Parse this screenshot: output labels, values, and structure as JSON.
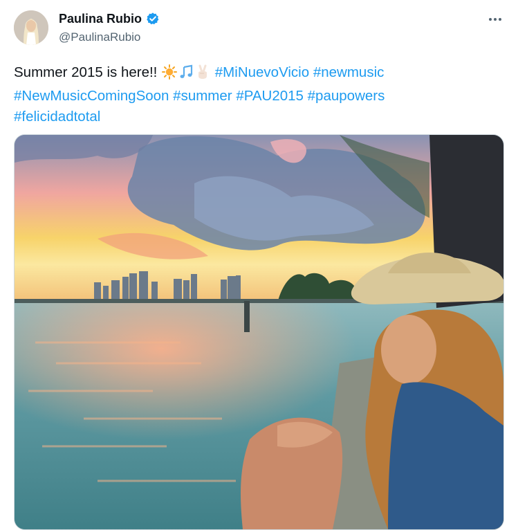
{
  "author": {
    "display_name": "Paulina Rubio",
    "handle": "@PaulinaRubio",
    "verified": true,
    "verified_color": "#1d9bf0"
  },
  "tweet": {
    "text_prefix": "Summer 2015 is here!!",
    "emojis": [
      "sun-emoji",
      "music-notes-emoji",
      "victory-hand-emoji"
    ],
    "hashtags": [
      "#MiNuevoVicio",
      "#newmusic",
      "#NewMusicComingSoon",
      "#summer",
      "#PAU2015",
      "#paupowers",
      "#felicidadtotal"
    ],
    "link_color": "#1d9bf0"
  },
  "media": {
    "type": "photo",
    "description_icon": "sunset-photo"
  }
}
